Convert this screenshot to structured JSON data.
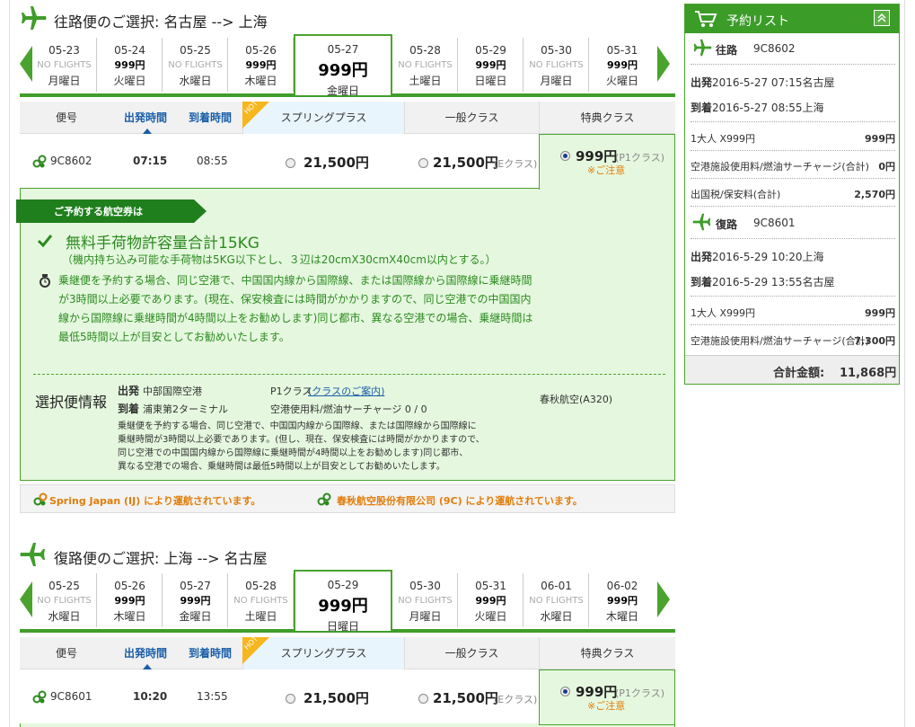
{
  "outbound": {
    "title": "往路便のご選択: 名古屋 --> 上海",
    "dates": [
      {
        "date": "05-23",
        "price": "NO FLIGHTS",
        "weekday": "月曜日"
      },
      {
        "date": "05-24",
        "price": "999円",
        "weekday": "火曜日"
      },
      {
        "date": "05-25",
        "price": "NO FLIGHTS",
        "weekday": "水曜日"
      },
      {
        "date": "05-26",
        "price": "999円",
        "weekday": "木曜日"
      },
      {
        "date": "05-28",
        "price": "NO FLIGHTS",
        "weekday": "土曜日"
      },
      {
        "date": "05-29",
        "price": "999円",
        "weekday": "日曜日"
      },
      {
        "date": "05-30",
        "price": "NO FLIGHTS",
        "weekday": "月曜日"
      },
      {
        "date": "05-31",
        "price": "999円",
        "weekday": "火曜日"
      }
    ],
    "selected": {
      "date": "05-27",
      "price": "999円",
      "weekday": "金曜日"
    },
    "flight": {
      "no": "9C8602",
      "dep": "07:15",
      "arr": "08:55",
      "spring_plus": "21,500円",
      "normal": "21,500円",
      "normal_class": "(Eクラス)",
      "special": "999円",
      "special_class": "(P1クラス)",
      "note": "※ご注意"
    }
  },
  "table_headers": {
    "flight_no": "便号",
    "dep": "出発時間",
    "arr": "到着時間",
    "hot": "HOT",
    "spring_plus": "スプリングプラス",
    "normal": "一般クラス",
    "special": "特典クラス"
  },
  "detail": {
    "ribbon": "ご予約する航空券は",
    "baggage_title": "無料手荷物許容量合計15KG",
    "baggage_sub": "（機内持ち込み可能な手荷物は5KG以下とし、３辺は20cmX30cmX40cm以内とする。）",
    "transfer_lines": [
      "乗継便を予約する場合、同じ空港で、中国国内線から国際線、または国際線から国際線に乗継時間",
      "が3時間以上必要であります。(現在、保安検査には時間がかかりますので、同じ空港での中国国内",
      "線から国際線に乗継時間が4時間以上をお勧めします)同じ都市、異なる空港での場合、乗継時間は",
      "最低5時間以上が目安としてお勧めいたします。"
    ],
    "info_label": "選択便情報",
    "dep_label": "出発",
    "dep_airport": "中部国際空港",
    "arr_label": "到着",
    "arr_airport": "浦東第2ターミナル",
    "class_label": "P1クラス",
    "class_link": "(クラスのご案内)",
    "surcharge": "空港使用料/燃油サーチャージ 0 / 0",
    "aircraft": "春秋航空(A320)",
    "small_lines": [
      "乗継便を予約する場合、同じ空港で、中国国内線から国際線、または国際線から国際線に",
      "乗継時間が3時間以上必要であります。(但し、現在、保安検査には時間がかかりますので、",
      "同じ空港での中国国内線から国際線に乗継時間が4時間以上をお勧めします)同じ都市、",
      "異なる空港での場合、乗継時間は最低5時間以上が目安としてお勧めいたします。"
    ]
  },
  "operated": {
    "ij": "Spring Japan (IJ) により運航されています。",
    "c9": "春秋航空股份有限公司 (9C) により運航されています。"
  },
  "return": {
    "title": "復路便のご選択: 上海 --> 名古屋",
    "dates": [
      {
        "date": "05-25",
        "price": "NO FLIGHTS",
        "weekday": "水曜日"
      },
      {
        "date": "05-26",
        "price": "999円",
        "weekday": "木曜日"
      },
      {
        "date": "05-27",
        "price": "999円",
        "weekday": "金曜日"
      },
      {
        "date": "05-28",
        "price": "NO FLIGHTS",
        "weekday": "土曜日"
      },
      {
        "date": "05-30",
        "price": "NO FLIGHTS",
        "weekday": "月曜日"
      },
      {
        "date": "05-31",
        "price": "999円",
        "weekday": "火曜日"
      },
      {
        "date": "06-01",
        "price": "NO FLIGHTS",
        "weekday": "水曜日"
      },
      {
        "date": "06-02",
        "price": "999円",
        "weekday": "木曜日"
      }
    ],
    "selected": {
      "date": "05-29",
      "price": "999円",
      "weekday": "日曜日"
    },
    "flight": {
      "no": "9C8601",
      "dep": "10:20",
      "arr": "13:55",
      "spring_plus": "21,500円",
      "normal": "21,500円",
      "normal_class": "(Eクラス)",
      "special": "999円",
      "special_class": "(P1クラス)",
      "note": "※ご注意"
    }
  },
  "sidebar": {
    "title": "予約リスト",
    "out_label": "往路",
    "out_flight": "9C8602",
    "out_dep_label": "出発",
    "out_dep": "2016-5-27 07:15名古屋",
    "out_arr_label": "到着",
    "out_arr": "2016-5-27 08:55上海",
    "out_pax": "1大人 X999円",
    "out_pax_amt": "999円",
    "out_fee": "空港施設使用料/燃油サーチャージ(合計)",
    "out_fee_amt": "0円",
    "tax": "出国税/保安料(合計)",
    "tax_amt": "2,570円",
    "ret_label": "復路",
    "ret_flight": "9C8601",
    "ret_dep_label": "出発",
    "ret_dep": "2016-5-29 10:20上海",
    "ret_arr_label": "到着",
    "ret_arr": "2016-5-29 13:55名古屋",
    "ret_pax": "1大人 X999円",
    "ret_pax_amt": "999円",
    "ret_fee": "空港施設使用料/燃油サーチャージ(合計)",
    "ret_fee_amt": "7,300円",
    "total_label": "合計金額:",
    "total": "11,868円"
  },
  "colors": {
    "green": "#3f9d2a",
    "dark_green": "#1f7f1c",
    "light_green_bg": "#e5f8df",
    "link_blue": "#1a5ea8",
    "orange": "#e27d0a"
  }
}
